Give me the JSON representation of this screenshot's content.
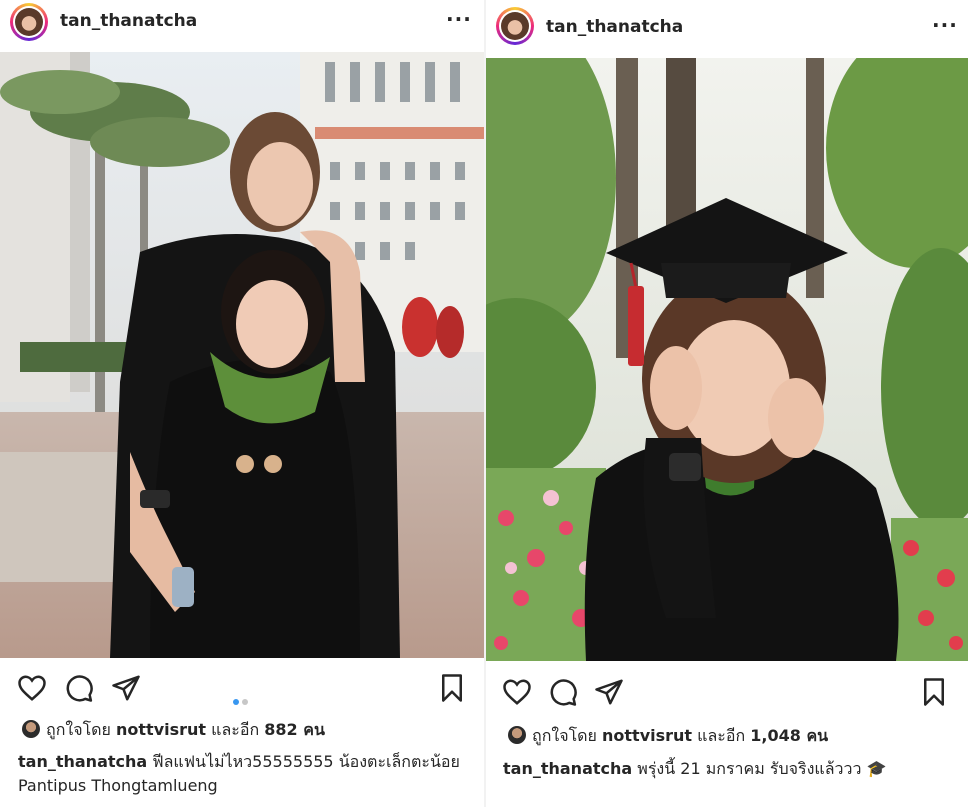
{
  "left_post": {
    "username": "tan_thanatcha",
    "more": "···",
    "likes": {
      "prefix": "ถูกใจโดย",
      "user": "nottvisrut",
      "middle": "และอีก",
      "count": "882 คน"
    },
    "caption": {
      "username": "tan_thanatcha",
      "text": "ฟีลแฟนไม่ไหว55555555 น้องตะเล็กตะน้อย  Pantipus Thongtamlueng"
    },
    "carousel": {
      "total": 2,
      "active": 1,
      "active_color": "#3897f0",
      "inactive_color": "#c7c7c7"
    }
  },
  "right_post": {
    "username": "tan_thanatcha",
    "more": "···",
    "likes": {
      "prefix": "ถูกใจโดย",
      "user": "nottvisrut",
      "middle": "และอีก",
      "count": "1,048 คน"
    },
    "caption": {
      "username": "tan_thanatcha",
      "text": "พรุ่งนี้ 21 มกราคม รับจริงแล้ววว 🎓"
    }
  },
  "icons": {
    "like": "heart-icon",
    "comment": "comment-icon",
    "share": "share-icon",
    "save": "bookmark-icon"
  }
}
